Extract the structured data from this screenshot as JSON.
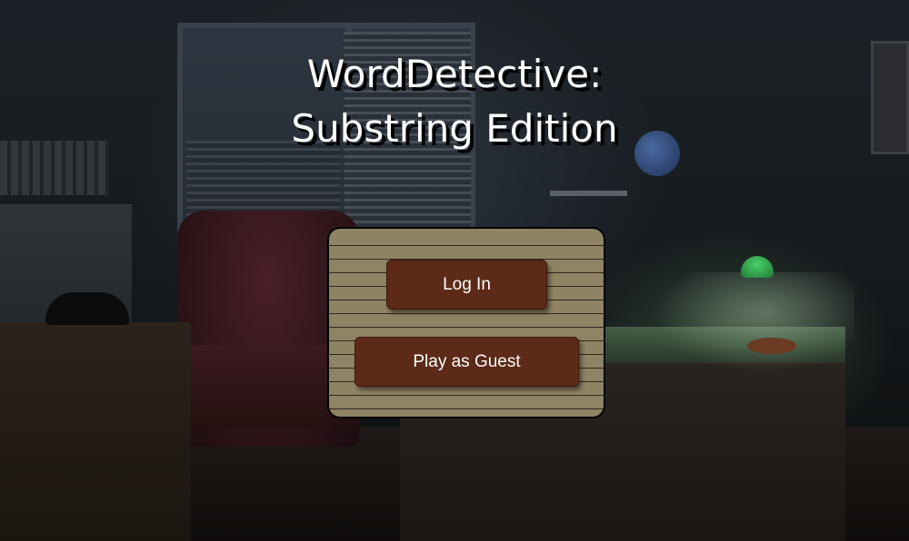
{
  "game": {
    "title_line1": "WordDetective:",
    "title_line2": "Substring Edition"
  },
  "menu": {
    "login_label": "Log In",
    "guest_label": "Play as Guest"
  },
  "colors": {
    "panel_bg": "#8e8363",
    "panel_lines": "#2e2a22",
    "button_bg": "#5c2a17",
    "button_text": "#ffffff",
    "title_text": "#ffffff",
    "title_shadow": "#000000"
  },
  "background": {
    "scene": "dark-detective-office",
    "icons": [
      "armchair-icon",
      "desk-lamp-icon",
      "globe-icon",
      "fedora-hat-icon",
      "window-blinds-icon"
    ]
  }
}
